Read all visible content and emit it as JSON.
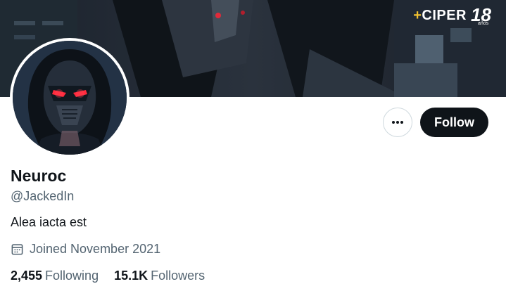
{
  "banner": {
    "watermark_brand_plus": "+",
    "watermark_brand": "CIPER",
    "watermark_years": "18",
    "watermark_years_sub": "años"
  },
  "profile": {
    "display_name": "Neuroc",
    "handle": "@JackedIn",
    "bio": "Alea iacta est",
    "joined": "Joined November 2021",
    "following_count": "2,455",
    "following_label": "Following",
    "followers_count": "15.1K",
    "followers_label": "Followers"
  },
  "actions": {
    "more_icon": "more-horizontal-icon",
    "follow_label": "Follow"
  },
  "icons": {
    "joined": "calendar-icon"
  },
  "colors": {
    "primary_text": "#0f1419",
    "secondary_text": "#536471",
    "follow_bg": "#0f1419",
    "border": "#cfd9de"
  }
}
